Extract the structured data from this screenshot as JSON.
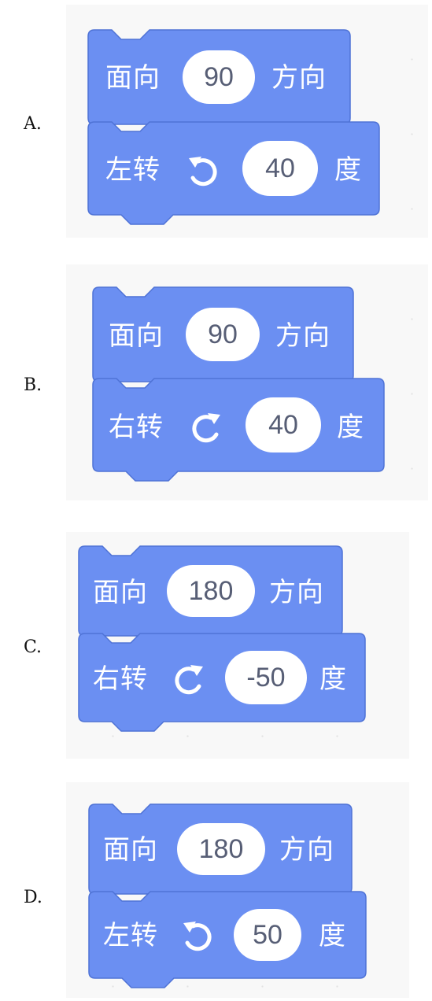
{
  "colors": {
    "block": "#6b8ff2",
    "block_border": "#4f73d6",
    "text": "#ffffff",
    "input_text": "#575e75"
  },
  "options": [
    {
      "label": "A.",
      "face_label": "面向",
      "direction": "90",
      "direction_suffix": "方向",
      "turn_label": "左转",
      "turn_icon": "rotate-left-icon",
      "degrees": "40",
      "degrees_suffix": "度"
    },
    {
      "label": "B.",
      "face_label": "面向",
      "direction": "90",
      "direction_suffix": "方向",
      "turn_label": "右转",
      "turn_icon": "rotate-right-icon",
      "degrees": "40",
      "degrees_suffix": "度"
    },
    {
      "label": "C.",
      "face_label": "面向",
      "direction": "180",
      "direction_suffix": "方向",
      "turn_label": "右转",
      "turn_icon": "rotate-right-icon",
      "degrees": "-50",
      "degrees_suffix": "度"
    },
    {
      "label": "D.",
      "face_label": "面向",
      "direction": "180",
      "direction_suffix": "方向",
      "turn_label": "左转",
      "turn_icon": "rotate-left-icon",
      "degrees": "50",
      "degrees_suffix": "度"
    }
  ]
}
